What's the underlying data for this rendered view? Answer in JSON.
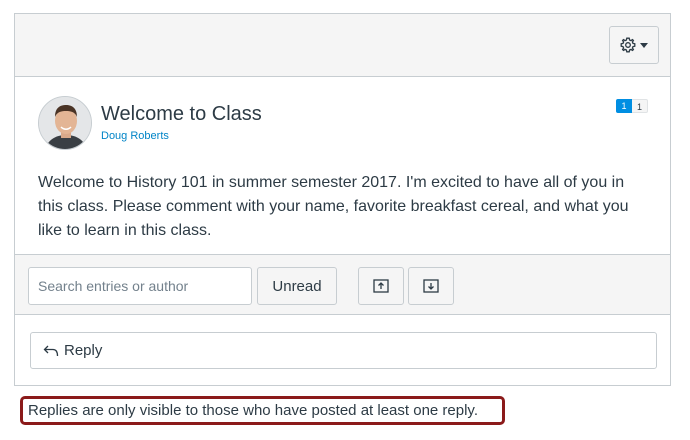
{
  "topic": {
    "title": "Welcome to Class",
    "author": "Doug Roberts",
    "unread_count": "1",
    "total_count": "1",
    "message": "Welcome to History 101 in summer semester 2017. I'm excited to have all of you in this class. Please comment with your name, favorite breakfast cereal, and what you like to learn in this class."
  },
  "toolbar": {
    "search_placeholder": "Search entries or author",
    "unread_label": "Unread"
  },
  "reply": {
    "label": "Reply"
  },
  "notice": "Replies are only visible to those who have posted at least one reply.",
  "icons": {
    "settings": "gear-icon",
    "collapse": "collapse-all-icon",
    "expand": "expand-all-icon",
    "reply": "reply-arrow-icon"
  },
  "colors": {
    "link": "#0084c7",
    "badge": "#008ee2",
    "highlight_border": "#8b1a1a"
  }
}
